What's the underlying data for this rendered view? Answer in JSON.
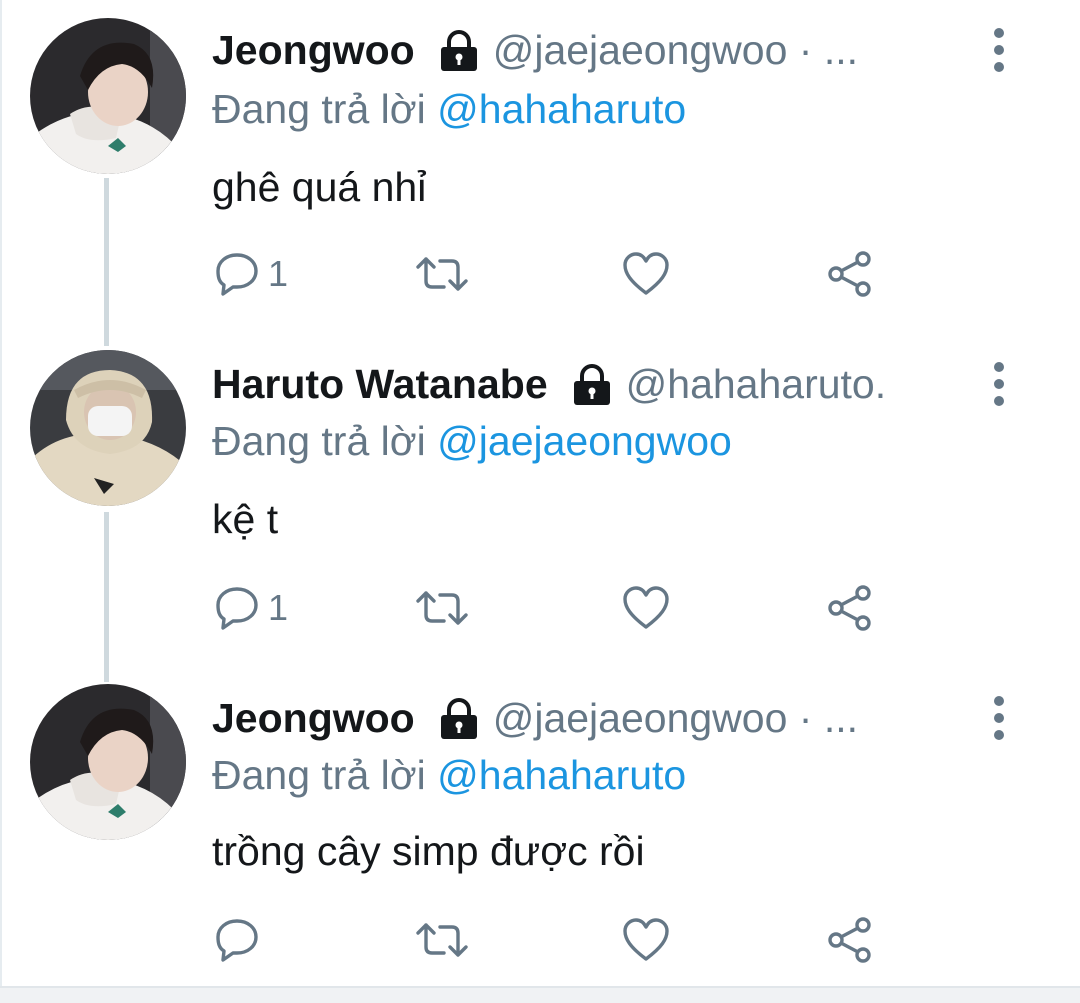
{
  "tweets": [
    {
      "name": "Jeongwoo",
      "handle": "@jaejaeongwoo · ...",
      "reply_prefix": "Đang trả lời",
      "reply_to": "@hahaharuto",
      "text": "ghê quá nhỉ",
      "reply_count": "1",
      "avatar": "jeongwoo-avatar"
    },
    {
      "name": "Haruto Watanabe",
      "handle": "@hahaharuto.",
      "reply_prefix": "Đang trả lời",
      "reply_to": "@jaejaeongwoo",
      "text": "kệ t",
      "reply_count": "1",
      "avatar": "haruto-avatar"
    },
    {
      "name": "Jeongwoo",
      "handle": "@jaejaeongwoo · ...",
      "reply_prefix": "Đang trả lời",
      "reply_to": "@hahaharuto",
      "text": "trồng cây simp được rồi",
      "reply_count": "",
      "avatar": "jeongwoo-avatar"
    }
  ],
  "icons": {
    "lock": "lock-icon",
    "reply": "reply-icon",
    "retweet": "retweet-icon",
    "like": "heart-icon",
    "share": "share-icon",
    "more": "more-vertical-icon"
  },
  "colors": {
    "name": "#14171a",
    "secondary": "#657786",
    "mention": "#1b95e0",
    "thread_line": "#cfd9de"
  }
}
